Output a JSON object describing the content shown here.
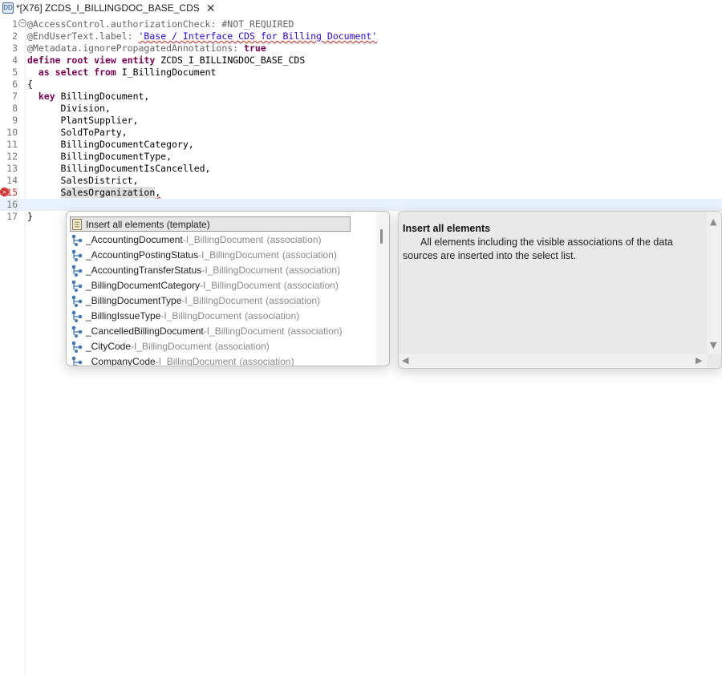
{
  "tab": {
    "icon_text": "DD",
    "title": "*[X76] ZCDS_I_BILLINGDOC_BASE_CDS",
    "close_glyph": "✕"
  },
  "editor": {
    "lines": [
      {
        "num": "1",
        "text": "@AccessControl.authorizationCheck: #NOT_REQUIRED"
      },
      {
        "num": "2",
        "text": "@EndUserText.label: 'Base / Interface CDS for Billing Document'"
      },
      {
        "num": "3",
        "text": "@Metadata.ignorePropagatedAnnotations: true"
      },
      {
        "num": "4",
        "text": "define root view entity ZCDS_I_BILLINGDOC_BASE_CDS"
      },
      {
        "num": "5",
        "text": "  as select from I_BillingDocument"
      },
      {
        "num": "6",
        "text": "{"
      },
      {
        "num": "7",
        "text": "  key BillingDocument,"
      },
      {
        "num": "8",
        "text": "      Division,"
      },
      {
        "num": "9",
        "text": "      PlantSupplier,"
      },
      {
        "num": "10",
        "text": "      SoldToParty,"
      },
      {
        "num": "11",
        "text": "      BillingDocumentCategory,"
      },
      {
        "num": "12",
        "text": "      BillingDocumentType,"
      },
      {
        "num": "13",
        "text": "      BillingDocumentIsCancelled,"
      },
      {
        "num": "14",
        "text": "      SalesDistrict,"
      },
      {
        "num": "15",
        "text": "      SalesOrganization,"
      },
      {
        "num": "16",
        "text": ""
      },
      {
        "num": "17",
        "text": "}"
      }
    ],
    "error_line": "15",
    "current_line": "16"
  },
  "completion": {
    "items": [
      {
        "name": "Insert all elements (template)",
        "source": "",
        "kind": ""
      },
      {
        "name": "_AccountingDocument",
        "source": "I_BillingDocument",
        "kind": "(association)"
      },
      {
        "name": "_AccountingPostingStatus",
        "source": "I_BillingDocument",
        "kind": "(association)"
      },
      {
        "name": "_AccountingTransferStatus",
        "source": "I_BillingDocument",
        "kind": "(association)"
      },
      {
        "name": "_BillingDocumentCategory",
        "source": "I_BillingDocument",
        "kind": "(association)"
      },
      {
        "name": "_BillingDocumentType",
        "source": "I_BillingDocument",
        "kind": "(association)"
      },
      {
        "name": "_BillingIssueType",
        "source": "I_BillingDocument",
        "kind": "(association)"
      },
      {
        "name": "_CancelledBillingDocument",
        "source": "I_BillingDocument",
        "kind": "(association)"
      },
      {
        "name": "_CityCode",
        "source": "I_BillingDocument",
        "kind": "(association)"
      },
      {
        "name": "_CompanyCode",
        "source": "I_BillingDocument",
        "kind": "(association)"
      }
    ],
    "separator": " - "
  },
  "info": {
    "title": "Insert all elements",
    "text": "All elements including the visible associations of the data sources are inserted into the select list."
  }
}
